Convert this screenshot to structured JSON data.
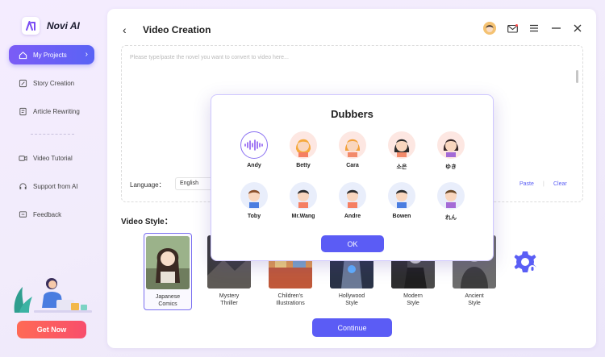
{
  "app": {
    "name": "Novi AI"
  },
  "sidebar": {
    "items": [
      {
        "label": "My Projects",
        "icon": "home-icon"
      },
      {
        "label": "Story Creation",
        "icon": "pencil-icon"
      },
      {
        "label": "Article Rewriting",
        "icon": "document-edit-icon"
      },
      {
        "label": "Video Tutorial",
        "icon": "video-icon"
      },
      {
        "label": "Support from AI",
        "icon": "headset-icon"
      },
      {
        "label": "Feedback",
        "icon": "chat-icon"
      }
    ],
    "cta_label": "Get Now"
  },
  "header": {
    "title": "Video Creation"
  },
  "editor": {
    "placeholder": "Please type/paste the novel you want to convert to video here...",
    "language_label": "Language：",
    "language_value": "English",
    "paste_label": "Paste",
    "clear_label": "Clear"
  },
  "video_style": {
    "label": "Video Style：",
    "styles": [
      {
        "line1": "Japanese",
        "line2": "Comics"
      },
      {
        "line1": "Mystery",
        "line2": "Thriller"
      },
      {
        "line1": "Children's",
        "line2": "Illustrations"
      },
      {
        "line1": "Hollywood",
        "line2": "Style"
      },
      {
        "line1": "Modern",
        "line2": "Style"
      },
      {
        "line1": "Ancient",
        "line2": "Style"
      }
    ],
    "continue_label": "Continue"
  },
  "dialog": {
    "title": "Dubbers",
    "dubbers": [
      {
        "name": "Andy"
      },
      {
        "name": "Betty"
      },
      {
        "name": "Cara"
      },
      {
        "name": "소은"
      },
      {
        "name": "ゆき"
      },
      {
        "name": "Toby"
      },
      {
        "name": "Mr.Wang"
      },
      {
        "name": "Andre"
      },
      {
        "name": "Bowen"
      },
      {
        "name": "れん"
      }
    ],
    "ok_label": "OK"
  },
  "colors": {
    "accent": "#5b5cf5",
    "cta": "#f84e6c"
  }
}
